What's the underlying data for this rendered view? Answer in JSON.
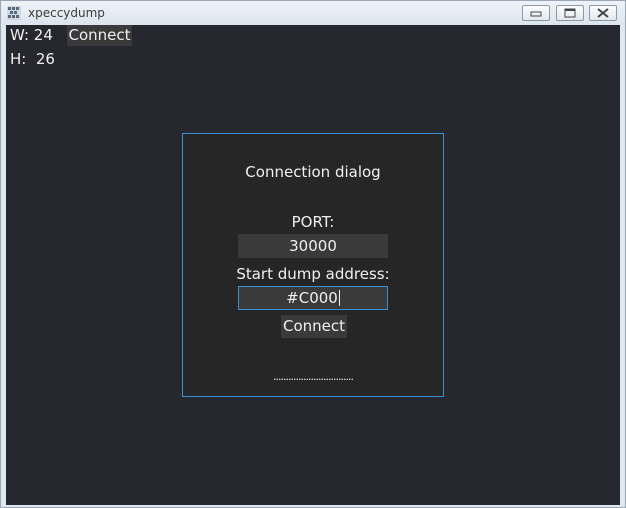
{
  "window": {
    "title": "xpeccydump",
    "controls": {
      "minimize_icon": "minimize-icon",
      "maximize_icon": "maximize-icon",
      "close_icon": "close-icon"
    }
  },
  "toolbar": {
    "width_label": "W: 24",
    "height_label": "H:  26",
    "connect_label": "Connect"
  },
  "dialog": {
    "title": "Connection dialog",
    "port_label": "PORT:",
    "port_value": "30000",
    "address_label": "Start dump address:",
    "address_value": "#C000",
    "connect_label": "Connect",
    "status": "................................"
  },
  "colors": {
    "background": "#272730",
    "dialog_bg": "#262626",
    "accent": "#3c8fd0",
    "control_bg": "#3a3a3a",
    "text": "#f0f0f0"
  }
}
